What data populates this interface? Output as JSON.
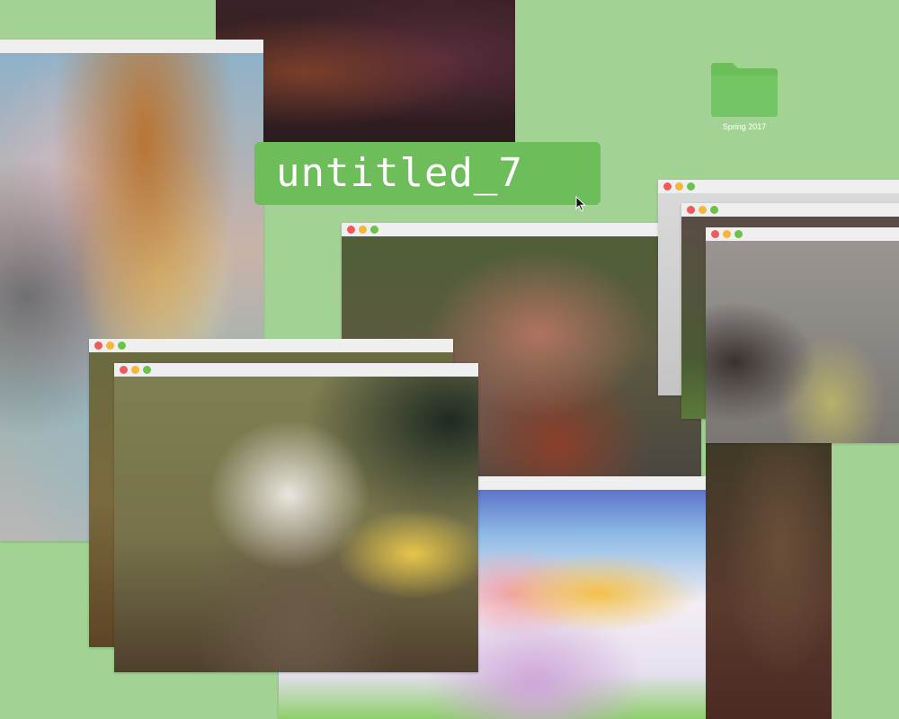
{
  "desktop": {
    "background": "#a3d394",
    "folder": {
      "label": "Spring 2017",
      "icon": "folder-icon",
      "color": "#6dbd5b"
    },
    "rename_field": {
      "value": "untitled_7"
    },
    "cursor": "arrow-cursor-icon"
  },
  "windows": [
    {
      "name": "photo-window-strip-top",
      "controls": false
    },
    {
      "name": "photo-window-left-tall",
      "controls": false
    },
    {
      "name": "photo-window-center-large",
      "controls": true
    },
    {
      "name": "photo-window-bottom-center",
      "controls": false
    },
    {
      "name": "photo-window-right-tall",
      "controls": false
    },
    {
      "name": "photo-window-left-back",
      "controls": true
    },
    {
      "name": "photo-window-left-front",
      "controls": true
    },
    {
      "name": "photo-window-right-back",
      "controls": true
    },
    {
      "name": "photo-window-right-middle",
      "controls": true
    },
    {
      "name": "photo-window-right-front",
      "controls": true
    }
  ],
  "window_controls": {
    "close": "#ef5b5b",
    "minimize": "#f3b73a",
    "zoom": "#6cc24a"
  }
}
